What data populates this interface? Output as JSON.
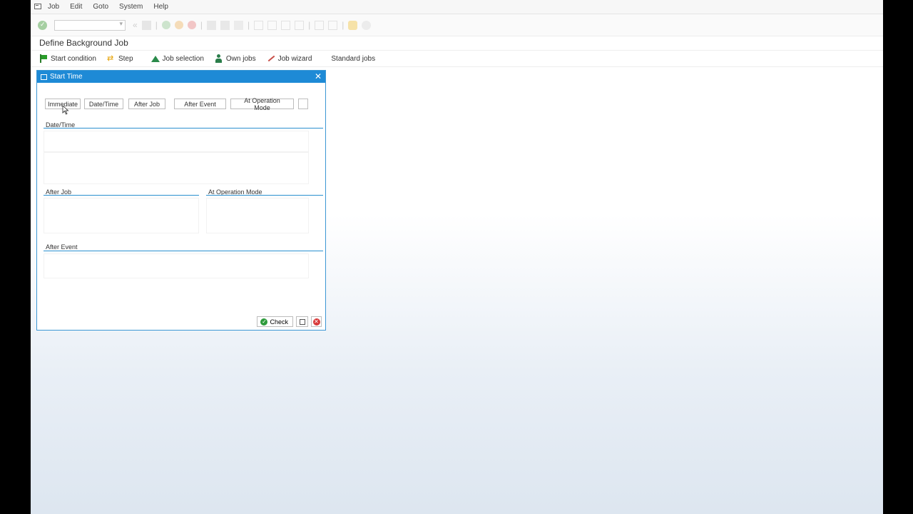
{
  "menu": [
    "Job",
    "Edit",
    "Goto",
    "System",
    "Help"
  ],
  "page_title": "Define Background Job",
  "app_toolbar": [
    {
      "label": "Start condition",
      "icon": "flag-icon"
    },
    {
      "label": "Step",
      "icon": "step-icon"
    },
    {
      "label": "Job selection",
      "icon": "mountain-icon"
    },
    {
      "label": "Own jobs",
      "icon": "person-icon"
    },
    {
      "label": "Job wizard",
      "icon": "wand-icon"
    },
    {
      "label": "Standard jobs",
      "icon": ""
    }
  ],
  "dialog": {
    "title": "Start Time",
    "buttons": [
      "Immediate",
      "Date/Time",
      "After Job",
      "After Event",
      "At Operation Mode",
      ""
    ],
    "sections": {
      "date_time": "Date/Time",
      "after_job": "After Job",
      "at_operation_mode": "At Operation Mode",
      "after_event": "After Event"
    },
    "check_label": "Check"
  },
  "colors": {
    "dialog_header": "#1e8ad6",
    "section_line": "#2a8fcf"
  }
}
